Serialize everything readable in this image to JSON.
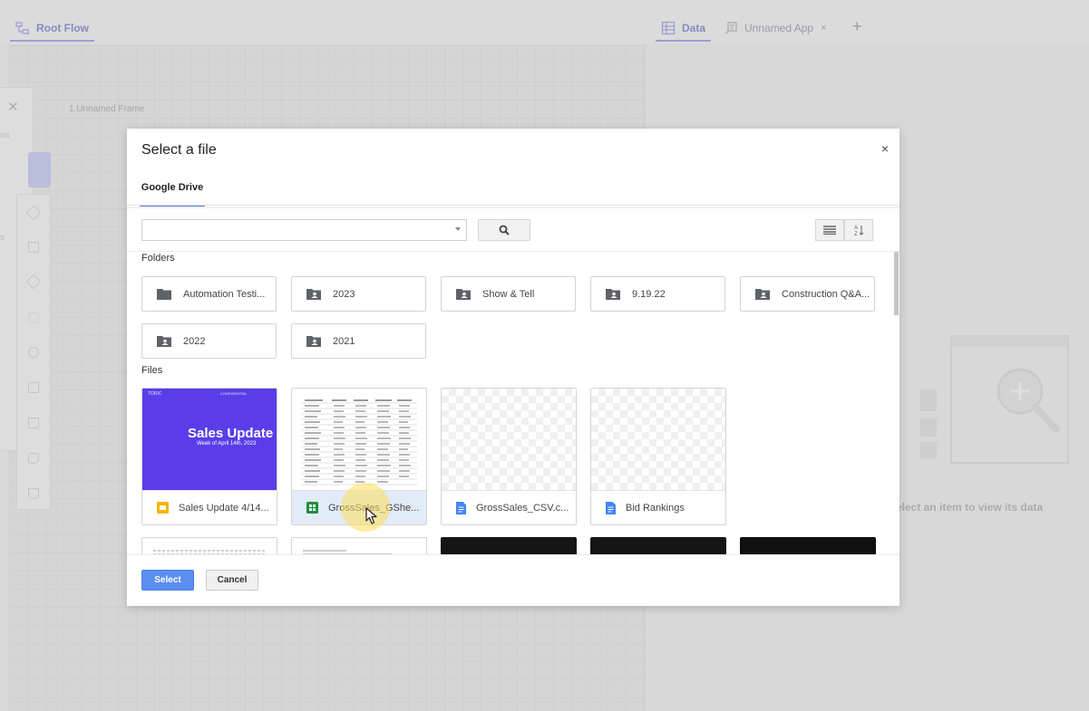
{
  "background": {
    "tabs": {
      "root_flow": "Root Flow",
      "data": "Data",
      "unnamed_app": "Unnamed App"
    },
    "frame_label": "1.Unnamed Frame",
    "empty_state": "elect an item to view its data",
    "drawer_fragments": [
      "es",
      "s"
    ]
  },
  "modal": {
    "title": "Select a file",
    "source_tab": "Google Drive",
    "search": {
      "value": "",
      "placeholder": ""
    },
    "sections": {
      "folders": "Folders",
      "files": "Files"
    },
    "folders": [
      {
        "name": "Automation Testi...",
        "icon": "folder-icon"
      },
      {
        "name": "2023",
        "icon": "shared-folder-icon"
      },
      {
        "name": "Show & Tell",
        "icon": "shared-folder-icon"
      },
      {
        "name": "9.19.22",
        "icon": "shared-folder-icon"
      },
      {
        "name": "Construction Q&A...",
        "icon": "shared-folder-icon"
      },
      {
        "name": "2022",
        "icon": "shared-folder-icon"
      },
      {
        "name": "2021",
        "icon": "shared-folder-icon"
      }
    ],
    "files": [
      {
        "name": "Sales Update 4/14...",
        "icon": "google-slides-icon",
        "thumb": {
          "brand": "TORIC",
          "confidential": "CONFIDENTIAL",
          "heading": "Sales Update",
          "sub": "Week of April 14th, 2023"
        }
      },
      {
        "name": "GrossSales_GShe...",
        "icon": "google-sheets-icon",
        "selected": true
      },
      {
        "name": "GrossSales_CSV.c...",
        "icon": "google-docs-icon"
      },
      {
        "name": "Bid Rankings",
        "icon": "google-docs-icon"
      }
    ],
    "buttons": {
      "select": "Select",
      "cancel": "Cancel",
      "close": "×"
    }
  },
  "colors": {
    "accent": "#5b8ef2",
    "slide_bg": "#5a3de8",
    "sheets_green": "#1e8e3e",
    "docs_blue": "#4285f4",
    "slides_yellow": "#f4b400"
  }
}
